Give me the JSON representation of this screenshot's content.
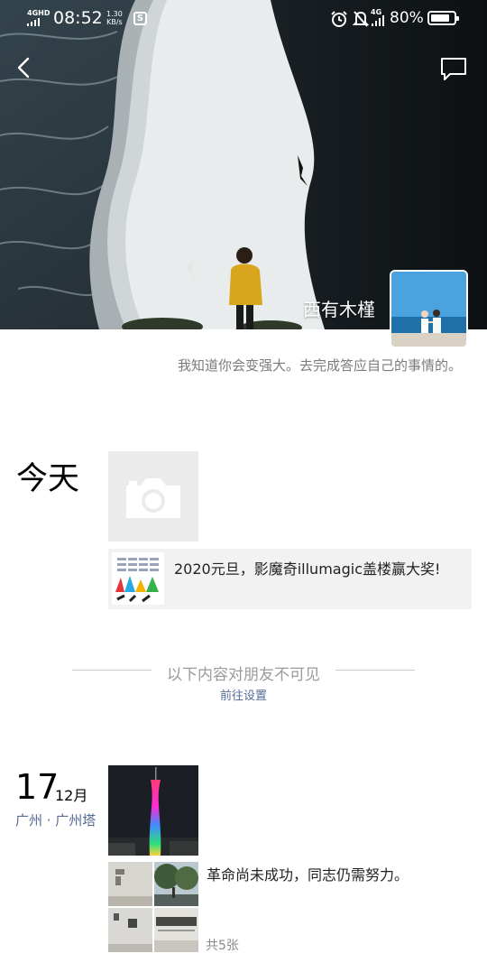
{
  "status_bar": {
    "network": "4GHD",
    "time": "08:52",
    "speed_value": "1.30",
    "speed_unit": "KB/s",
    "net_type": "4G",
    "battery": "80%"
  },
  "icons": {
    "back": "back-arrow-icon",
    "comment": "comment-bubble-icon",
    "camera": "camera-icon",
    "alarm": "alarm-clock-icon",
    "mute": "muted-bell-icon"
  },
  "profile": {
    "name": "西有木槿",
    "signature": "我知道你会变强大。去完成答应自己的事情的。"
  },
  "today": {
    "label": "今天",
    "share_text": "2020元旦，影魔奇illumagic盖楼赢大奖!"
  },
  "privacy": {
    "notice": "以下内容对朋友不可见",
    "settings_link": "前往设置"
  },
  "post": {
    "day": "17",
    "month": "12月",
    "location": "广州 · 广州塔",
    "text": "革命尚未成功，同志仍需努力。",
    "photo_count": "共5张"
  },
  "colors": {
    "link": "#576b95",
    "muted": "#9a9a9a"
  }
}
